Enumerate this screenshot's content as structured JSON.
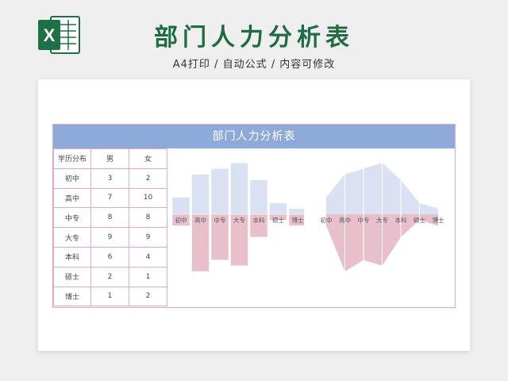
{
  "header": {
    "title": "部门人力分析表",
    "subtitle": "A4打印 / 自动公式 / 内容可修改"
  },
  "logo": {
    "letter": "X",
    "color": "#1e7145",
    "icon": "excel-icon"
  },
  "sheet": {
    "title": "部门人力分析表",
    "columns": [
      "学历分布",
      "男",
      "女"
    ],
    "rows": [
      {
        "label": "初中",
        "male": "3",
        "female": "2"
      },
      {
        "label": "高中",
        "male": "7",
        "female": "10"
      },
      {
        "label": "中专",
        "male": "8",
        "female": "8"
      },
      {
        "label": "大专",
        "male": "9",
        "female": "9"
      },
      {
        "label": "本科",
        "male": "6",
        "female": "4"
      },
      {
        "label": "硕士",
        "male": "2",
        "female": "1"
      },
      {
        "label": "博士",
        "male": "1",
        "female": "2"
      }
    ]
  },
  "colors": {
    "male": "#d9e1f2",
    "female": "#e8c0cc",
    "header": "#8eaadb",
    "border": "#e6a9bd"
  },
  "chart_data": [
    {
      "type": "bar",
      "categories": [
        "初中",
        "高中",
        "中专",
        "大专",
        "本科",
        "硕士",
        "博士"
      ],
      "series": [
        {
          "values": [
            3,
            7,
            8,
            9,
            6,
            2,
            1
          ]
        },
        {
          "values": [
            2,
            10,
            8,
            9,
            4,
            1,
            2
          ]
        }
      ]
    },
    {
      "type": "area",
      "categories": [
        "初中",
        "高中",
        "中专",
        "大专",
        "本科",
        "硕士",
        "博士"
      ],
      "series": [
        {
          "values": [
            3,
            7,
            8,
            9,
            6,
            2,
            1
          ]
        },
        {
          "values": [
            2,
            10,
            8,
            9,
            4,
            1,
            2
          ]
        }
      ]
    }
  ]
}
